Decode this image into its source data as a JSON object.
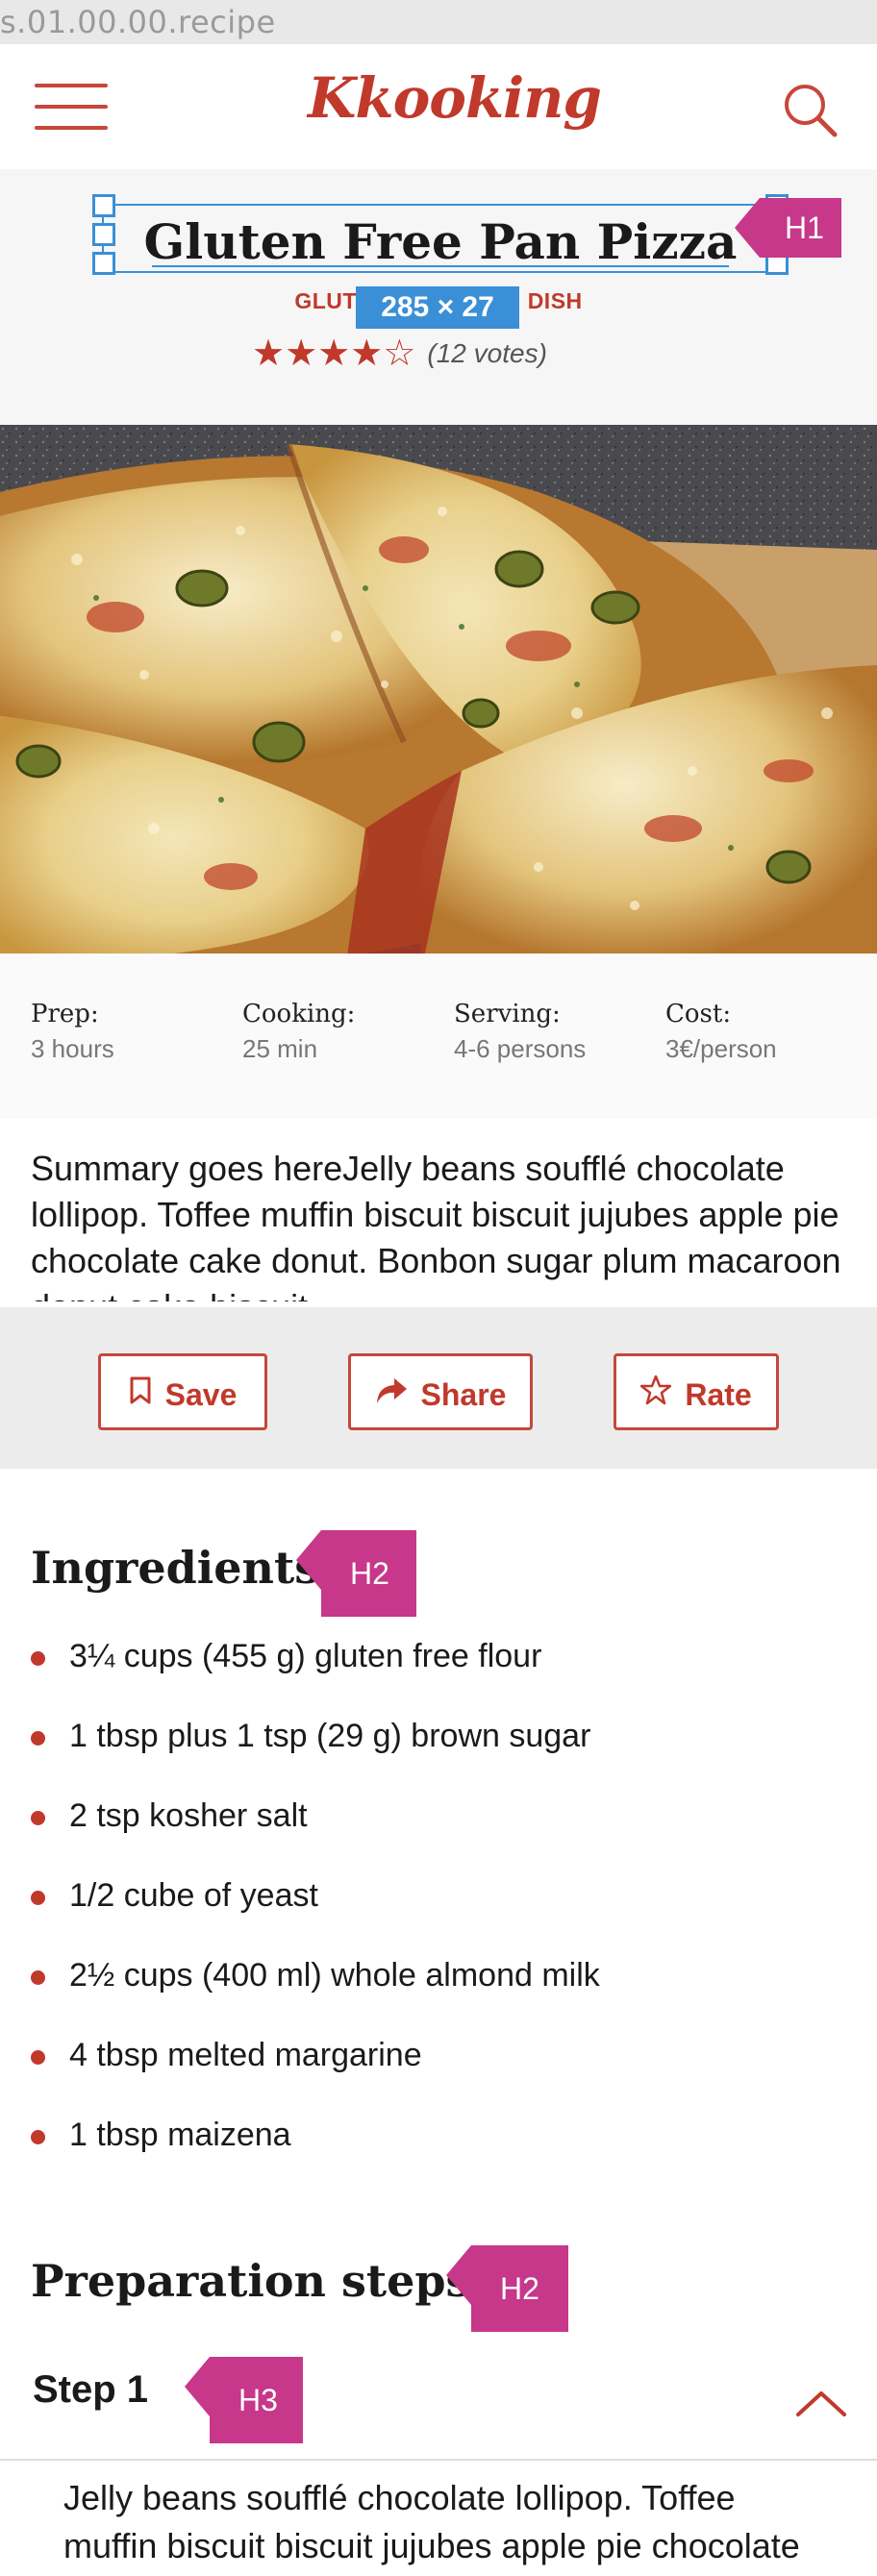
{
  "filename_bar": {
    "text": "s.01.00.00.recipe"
  },
  "header": {
    "logo_text": "Kkooking",
    "menu_icon": "hamburger-menu-icon",
    "search_icon": "search-icon"
  },
  "recipe": {
    "title": "Gluten Free Pan Pizza",
    "category": "GLUTEN FREE  MAIN DISH",
    "rating": 4,
    "rating_max": 5,
    "votes_text": "(12 votes)"
  },
  "annotations": {
    "h1": "H1",
    "h2": "H2",
    "h3": "H3",
    "dimensions": "285 × 27"
  },
  "hero": {
    "image_description": "pizza-photo"
  },
  "stats": [
    {
      "label": "Prep:",
      "value": "3 hours"
    },
    {
      "label": "Cooking:",
      "value": "25 min"
    },
    {
      "label": "Serving:",
      "value": "4-6 persons"
    },
    {
      "label": "Cost:",
      "value": "3€/person"
    }
  ],
  "summary": "Summary goes hereJelly beans soufflé chocolate lollipop. Toffee muffin biscuit biscuit jujubes apple pie chocolate cake donut. Bonbon sugar plum macaroon donut cake biscuit.",
  "actions": {
    "save": {
      "label": "Save",
      "icon": "bookmark-icon"
    },
    "share": {
      "label": "Share",
      "icon": "share-arrow-icon"
    },
    "rate": {
      "label": "Rate",
      "icon": "star-outline-icon"
    }
  },
  "ingredients": {
    "heading": "Ingredients",
    "items": [
      "3¼ cups (455 g) gluten free flour",
      "1 tbsp plus 1 tsp (29 g) brown sugar",
      "2 tsp kosher salt",
      "1/2 cube of yeast",
      "2½ cups (400 ml) whole almond milk",
      "4 tbsp melted margarine",
      "1 tbsp maizena"
    ]
  },
  "preparation": {
    "heading": "Preparation steps",
    "steps": [
      {
        "title": "Step 1",
        "text": "Jelly beans soufflé chocolate lollipop. Toffee muffin biscuit biscuit jujubes apple pie chocolate cake donut."
      }
    ]
  },
  "colors": {
    "accent": "#c0392b",
    "annotation_tag": "#c7378a",
    "selection": "#3a8fd6"
  }
}
